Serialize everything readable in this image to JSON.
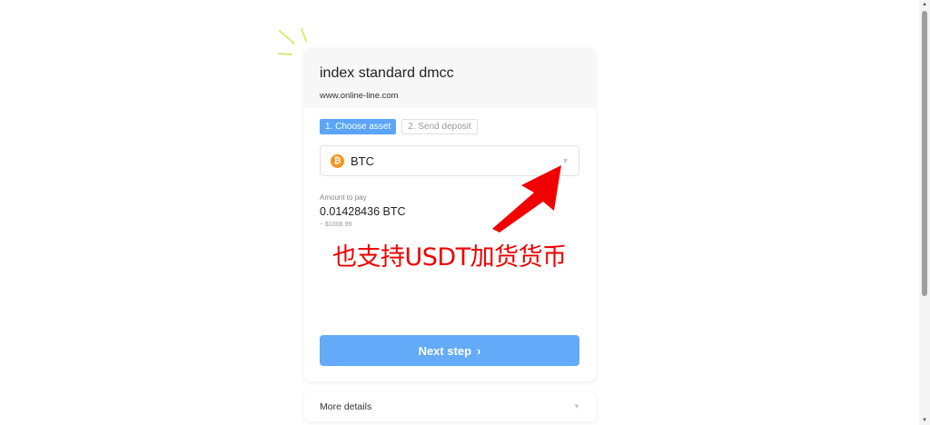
{
  "merchant": {
    "name": "index standard dmcc",
    "url": "www.online-line.com"
  },
  "steps": [
    {
      "label": "1. Choose asset",
      "active": true
    },
    {
      "label": "2. Send deposit",
      "active": false
    }
  ],
  "asset_select": {
    "icon": "bitcoin-icon",
    "icon_glyph": "₿",
    "selected": "BTC",
    "caret": "▼"
  },
  "amount": {
    "caption": "Amount to pay",
    "value": "0.01428436 BTC",
    "fiat": "~ $1008.99"
  },
  "next_button": {
    "label": "Next step",
    "chevron": "›",
    "color": "#63aaf8"
  },
  "details": {
    "label": "More details",
    "caret": "▼"
  },
  "annotation": {
    "text": "也支持USDT加货货币",
    "color": "#f00000"
  },
  "scrollbar": {
    "up": "▲",
    "down": "▼"
  }
}
